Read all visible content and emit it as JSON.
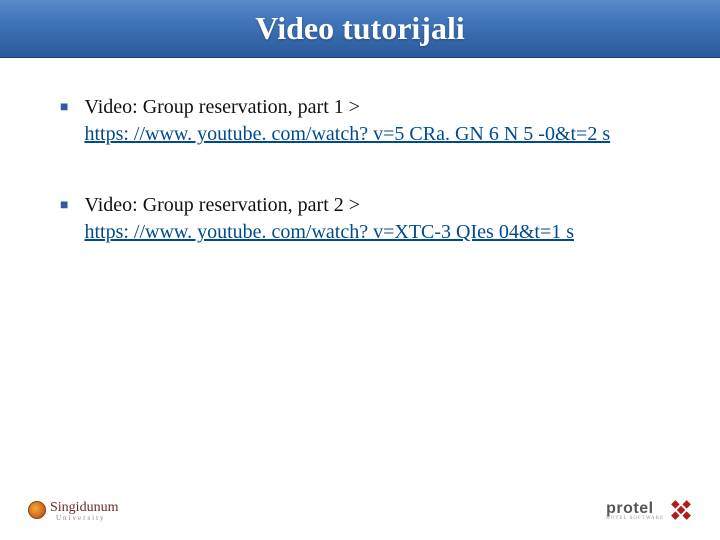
{
  "title": "Video tutorijali",
  "bullets": [
    {
      "lead": "Video: Group reservation, part 1 >",
      "link": "https: //www. youtube. com/watch? v=5 CRa. GN 6 N 5 -0&t=2 s"
    },
    {
      "lead": "Video: Group reservation, part 2 >",
      "link": "https: //www. youtube. com/watch? v=XTC-3 QIes 04&t=1 s"
    }
  ],
  "footer": {
    "left_name": "Singidunum",
    "left_sub": "University",
    "right_name": "protel",
    "right_sub": "HOTEL SOFTWARE"
  }
}
